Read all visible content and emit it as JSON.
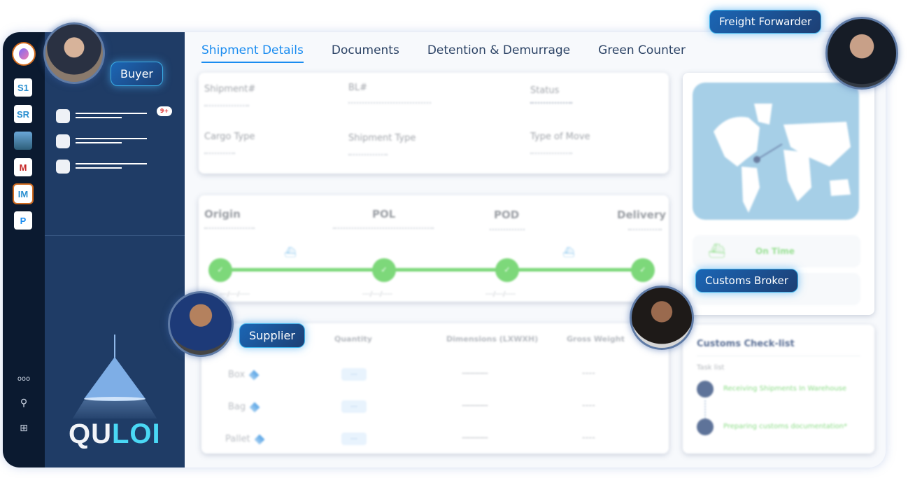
{
  "rail": {
    "items": [
      {
        "label": "S1",
        "icon": "s1-app-icon"
      },
      {
        "label": "SR",
        "icon": "sr-app-icon"
      },
      {
        "label": "",
        "icon": "port-photo-app-icon"
      },
      {
        "label": "M",
        "icon": "m-app-icon"
      },
      {
        "label": "IM",
        "icon": "im-app-icon",
        "active": true
      },
      {
        "label": "P",
        "icon": "p-app-icon"
      }
    ],
    "more": "ooo",
    "search": "⚲",
    "add": "⊞"
  },
  "panel": {
    "badge": "9+",
    "brand_white": "QU",
    "brand_cyan": "LOI"
  },
  "tabs": [
    "Shipment Details",
    "Documents",
    "Detention & Demurrage",
    "Green Counter"
  ],
  "details": {
    "fields": [
      {
        "label": "Shipment#",
        "value": "--------------"
      },
      {
        "label": "BL#",
        "value": "--------------------"
      },
      {
        "label": "Status",
        "value": "--------"
      },
      {
        "label": "Cargo Type",
        "value": "--------"
      },
      {
        "label": "Shipment Type",
        "value": "----------"
      },
      {
        "label": "Type of Move",
        "value": "-----------"
      }
    ]
  },
  "route": {
    "stages": [
      {
        "label": "Origin",
        "value": "-------------",
        "date": "---/---/----"
      },
      {
        "label": "POL",
        "value": "-----------------------",
        "date": "---/---/----"
      },
      {
        "label": "POD",
        "value": "---------",
        "date": "---/---/----"
      },
      {
        "label": "Delivery",
        "value": "--------",
        "date": ""
      }
    ],
    "node_glyph": "✓"
  },
  "cargo_table": {
    "headers": [
      "Quantity",
      "Dimensions (LXWXH)",
      "Gross Weight"
    ],
    "rows": [
      {
        "type": "Box",
        "qty": "---",
        "dims": "----------",
        "weight": "----"
      },
      {
        "type": "Bag",
        "qty": "---",
        "dims": "----------",
        "weight": "----"
      },
      {
        "type": "Pallet",
        "qty": "---",
        "dims": "----------",
        "weight": "----"
      }
    ]
  },
  "tracking": {
    "status": "On Time"
  },
  "customs": {
    "title": "Customs Check-list",
    "subtitle": "Task list",
    "tasks": [
      "Receiving Shipments In Warehouse",
      "Preparing customs documentation*"
    ]
  },
  "roles": {
    "buyer": "Buyer",
    "freight_forwarder": "Freight Forwarder",
    "supplier": "Supplier",
    "customs_broker": "Customs Broker"
  }
}
